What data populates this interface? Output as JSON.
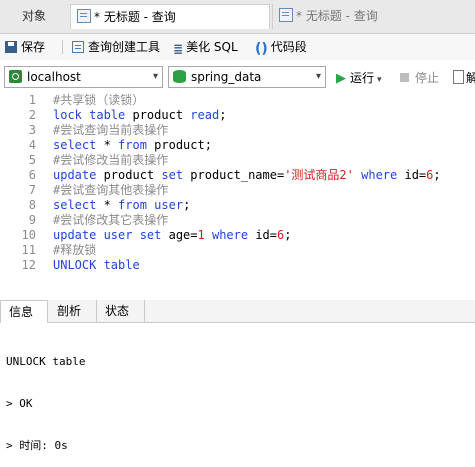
{
  "tabs": {
    "objects": "对象",
    "query1": "* 无标题 - 查询",
    "query2": "* 无标题 - 查询"
  },
  "toolbar": {
    "save": "保存",
    "query_builder": "查询创建工具",
    "beautify": "美化 SQL",
    "snippet": "代码段"
  },
  "connection": {
    "server": "localhost",
    "database": "spring_data",
    "run": "运行",
    "stop": "停止",
    "explain": "解"
  },
  "editor": {
    "lines": [
      {
        "n": "1",
        "tokens": [
          [
            "cmt",
            "#共享锁（读锁）"
          ]
        ]
      },
      {
        "n": "2",
        "tokens": [
          [
            "kw",
            "lock table "
          ],
          [
            "id",
            "product "
          ],
          [
            "kw",
            "read"
          ],
          [
            "id",
            ";"
          ]
        ]
      },
      {
        "n": "3",
        "tokens": [
          [
            "cmt",
            "#尝试查询当前表操作"
          ]
        ]
      },
      {
        "n": "4",
        "tokens": [
          [
            "kw",
            "select "
          ],
          [
            "id",
            "* "
          ],
          [
            "kw",
            "from "
          ],
          [
            "id",
            "product;"
          ]
        ]
      },
      {
        "n": "5",
        "tokens": [
          [
            "cmt",
            "#尝试修改当前表操作"
          ]
        ]
      },
      {
        "n": "6",
        "tokens": [
          [
            "kw",
            "update "
          ],
          [
            "id",
            "product "
          ],
          [
            "kw",
            "set "
          ],
          [
            "id",
            "product_name="
          ],
          [
            "str",
            "'测试商品2'"
          ],
          [
            "kw",
            " where "
          ],
          [
            "id",
            "id="
          ],
          [
            "num",
            "6"
          ],
          [
            "id",
            ";"
          ]
        ]
      },
      {
        "n": "7",
        "tokens": [
          [
            "cmt",
            "#尝试查询其他表操作"
          ]
        ]
      },
      {
        "n": "8",
        "tokens": [
          [
            "kw",
            "select "
          ],
          [
            "id",
            "* "
          ],
          [
            "kw",
            "from "
          ],
          [
            "kw",
            "user"
          ],
          [
            "id",
            ";"
          ]
        ]
      },
      {
        "n": "9",
        "tokens": [
          [
            "cmt",
            "#尝试修改其它表操作"
          ]
        ]
      },
      {
        "n": "10",
        "tokens": [
          [
            "kw",
            "update "
          ],
          [
            "kw",
            "user "
          ],
          [
            "kw",
            "set "
          ],
          [
            "id",
            "age="
          ],
          [
            "num",
            "1"
          ],
          [
            "kw",
            " where "
          ],
          [
            "id",
            "id="
          ],
          [
            "num",
            "6"
          ],
          [
            "id",
            ";"
          ]
        ]
      },
      {
        "n": "11",
        "tokens": [
          [
            "cmt",
            "#释放锁"
          ]
        ]
      },
      {
        "n": "12",
        "tokens": [
          [
            "kw",
            "UNLOCK table"
          ]
        ]
      }
    ]
  },
  "results": {
    "tabs": [
      "信息",
      "剖析",
      "状态"
    ],
    "lines": [
      "UNLOCK table",
      "> OK",
      "> 时间: 0s"
    ]
  },
  "colors": {
    "keyword": "#2244dd",
    "comment": "#8c8c8c",
    "string": "#cc2222",
    "run_green": "#2aa64a"
  },
  "icons": [
    "save-icon",
    "query-builder-icon",
    "beautify-icon",
    "snippet-icon",
    "connection-icon",
    "database-icon",
    "run-icon",
    "stop-icon",
    "query-tab-icon"
  ]
}
